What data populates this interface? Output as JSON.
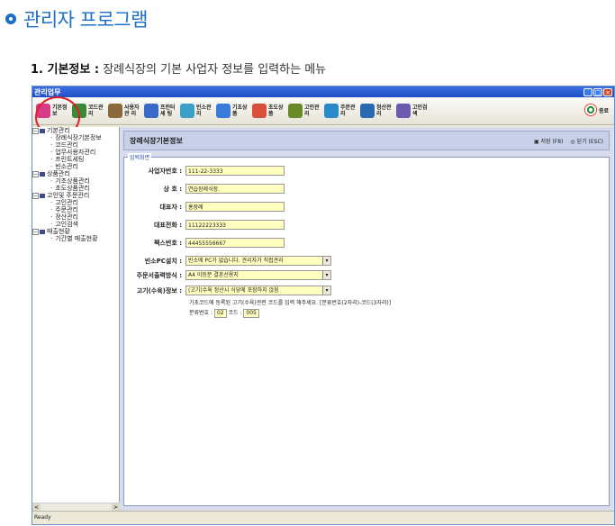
{
  "page": {
    "heading": "관리자 프로그램",
    "section_number": "1. 기본정보 :",
    "section_desc": " 장례식장의 기본 사업자 정보를 입력하는 메뉴"
  },
  "app": {
    "window_title": "관리업무",
    "toolbar": [
      {
        "label": "기본정보",
        "icon": "book-icon",
        "color": "#d83a8a"
      },
      {
        "label": "코드관리",
        "icon": "puzzle-icon",
        "color": "#3a8a3a"
      },
      {
        "label": "사용자관 리",
        "icon": "users-icon",
        "color": "#8a6a3a"
      },
      {
        "label": "프린터세 팅",
        "icon": "printer-icon",
        "color": "#3a6ac8"
      },
      {
        "label": "빈소관리",
        "icon": "room-icon",
        "color": "#3aa0c8"
      },
      {
        "label": "기초상품",
        "icon": "box-icon",
        "color": "#3a7ad8"
      },
      {
        "label": "초도상품",
        "icon": "gift-icon",
        "color": "#d8503a"
      },
      {
        "label": "고인관리",
        "icon": "person-icon",
        "color": "#6a8a2a"
      },
      {
        "label": "주문관리",
        "icon": "order-icon",
        "color": "#2a8ac8"
      },
      {
        "label": "정산관리",
        "icon": "calc-icon",
        "color": "#2a6ab0"
      },
      {
        "label": "고인검색",
        "icon": "search-person-icon",
        "color": "#6a5ab0"
      }
    ],
    "exit_label": "종료",
    "tree": [
      {
        "label": "기본관리",
        "level": 0
      },
      {
        "label": "장례식장기본정보",
        "level": 1
      },
      {
        "label": "코드관리",
        "level": 1
      },
      {
        "label": "업무사용자관리",
        "level": 1
      },
      {
        "label": "프린트세팅",
        "level": 1
      },
      {
        "label": "빈소관리",
        "level": 1
      },
      {
        "label": "상품관리",
        "level": 0
      },
      {
        "label": "기초상품관리",
        "level": 1
      },
      {
        "label": "초도상품관리",
        "level": 1
      },
      {
        "label": "고인및 주문관리",
        "level": 0
      },
      {
        "label": "고인관리",
        "level": 1
      },
      {
        "label": "주문관리",
        "level": 1
      },
      {
        "label": "정산관리",
        "level": 1
      },
      {
        "label": "고인검색",
        "level": 1
      },
      {
        "label": "매출현황",
        "level": 0
      },
      {
        "label": "기간별 매출현황",
        "level": 1
      }
    ],
    "main_title": "장례식장기본정보",
    "save_label": "저장 (F8)",
    "close_label": "닫기 (ESC)",
    "panel_caption": "입력화면",
    "fields": {
      "biz_no_label": "사업자번호 :",
      "biz_no": "111-22-3333",
      "name_label": "상 호 :",
      "name": "연습장례식장.",
      "ceo_label": "대표자 :",
      "ceo": "홍장례",
      "phone_label": "대표전화 :",
      "phone": "11122223333",
      "fax_label": "팩스번호 :",
      "fax": "44455556667",
      "pc_label": "빈소PC설치 :",
      "pc_value": "빈소에 PC가 없습니다. 관리자가 직접관리",
      "print_label": "주문서출력방식 :",
      "print_value": "A4 이등분 결혼선용지",
      "meat_label": "고기(수육)정보 :",
      "meat_value": "(고기)수육 정산시 식당에 포함하지 않음",
      "help_text": "기초코드에 등록된 고기(수육)관련 코드를 입력 해주세요. [분류번호(2자리)-코드(3자리)]",
      "class_label": "분류번호 :",
      "class_value": "02",
      "code_label": "코드 :",
      "code_value": "005"
    },
    "status": "Ready"
  }
}
